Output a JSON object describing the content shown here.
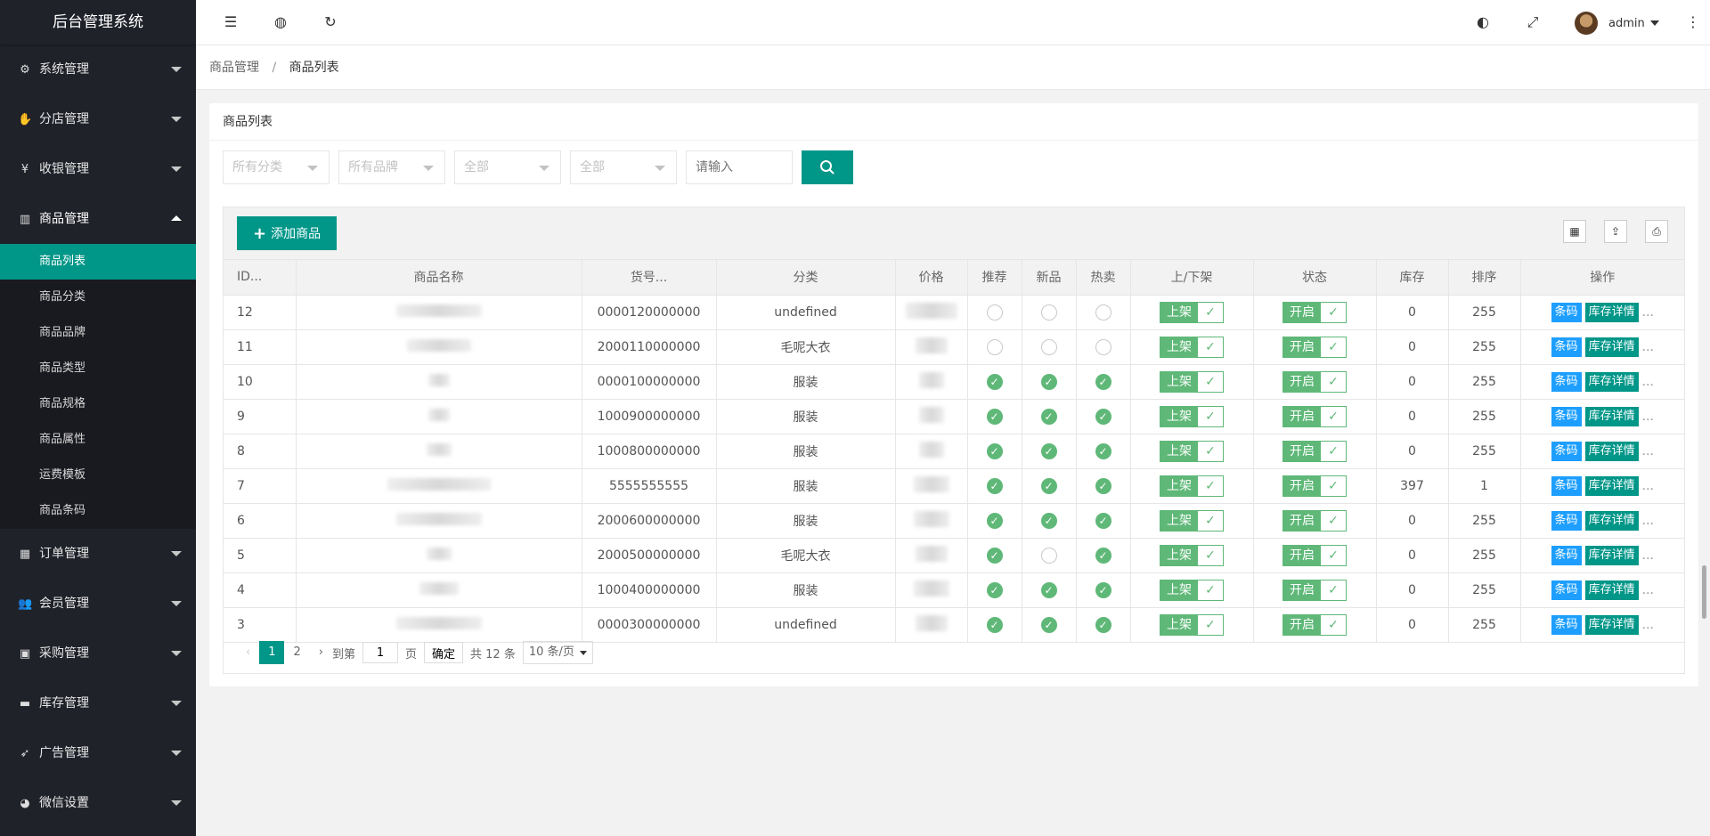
{
  "app_title": "后台管理系统",
  "sidebar": {
    "top_items": [
      {
        "label": "系统管理",
        "icon": "gear-icon",
        "glyph": "⚙"
      },
      {
        "label": "分店管理",
        "icon": "hand-icon",
        "glyph": "✋"
      },
      {
        "label": "收银管理",
        "icon": "yen-icon",
        "glyph": "¥"
      },
      {
        "label": "商品管理",
        "icon": "bar-chart-icon",
        "glyph": "▥"
      }
    ],
    "sub_items": [
      "商品列表",
      "商品分类",
      "商品品牌",
      "商品类型",
      "商品规格",
      "商品属性",
      "运费模板",
      "商品条码"
    ],
    "bottom_items": [
      {
        "label": "订单管理",
        "icon": "calendar-icon",
        "glyph": "▦"
      },
      {
        "label": "会员管理",
        "icon": "users-icon",
        "glyph": "👥"
      },
      {
        "label": "采购管理",
        "icon": "briefcase-icon",
        "glyph": "▣"
      },
      {
        "label": "库存管理",
        "icon": "folder-icon",
        "glyph": "▬"
      },
      {
        "label": "广告管理",
        "icon": "rocket-icon",
        "glyph": "➶"
      },
      {
        "label": "微信设置",
        "icon": "wechat-icon",
        "glyph": "◕"
      }
    ]
  },
  "header": {
    "user_name": "admin"
  },
  "breadcrumb": {
    "parent": "商品管理",
    "separator": "/",
    "current": "商品列表"
  },
  "card": {
    "title": "商品列表",
    "filters": {
      "category": "所有分类",
      "brand": "所有品牌",
      "filter3": "全部",
      "filter4": "全部",
      "search_placeholder": "请输入"
    },
    "add_button": "添加商品"
  },
  "table": {
    "columns": [
      "ID...",
      "商品名称",
      "货号...",
      "分类",
      "价格",
      "推荐",
      "新品",
      "热卖",
      "上/下架",
      "状态",
      "库存",
      "排序",
      "操作"
    ],
    "rows": [
      {
        "id": "12",
        "sku": "0000120000000",
        "category": "undefined",
        "rec": false,
        "new": false,
        "hot": false,
        "shelf": "上架",
        "status": "开启",
        "stock": "0",
        "sort": "255"
      },
      {
        "id": "11",
        "sku": "2000110000000",
        "category": "毛呢大衣",
        "rec": false,
        "new": false,
        "hot": false,
        "shelf": "上架",
        "status": "开启",
        "stock": "0",
        "sort": "255"
      },
      {
        "id": "10",
        "sku": "0000100000000",
        "category": "服装",
        "rec": true,
        "new": true,
        "hot": true,
        "shelf": "上架",
        "status": "开启",
        "stock": "0",
        "sort": "255"
      },
      {
        "id": "9",
        "sku": "1000900000000",
        "category": "服装",
        "rec": true,
        "new": true,
        "hot": true,
        "shelf": "上架",
        "status": "开启",
        "stock": "0",
        "sort": "255"
      },
      {
        "id": "8",
        "sku": "1000800000000",
        "category": "服装",
        "rec": true,
        "new": true,
        "hot": true,
        "shelf": "上架",
        "status": "开启",
        "stock": "0",
        "sort": "255"
      },
      {
        "id": "7",
        "sku": "5555555555",
        "category": "服装",
        "rec": true,
        "new": true,
        "hot": true,
        "shelf": "上架",
        "status": "开启",
        "stock": "397",
        "sort": "1"
      },
      {
        "id": "6",
        "sku": "2000600000000",
        "category": "服装",
        "rec": true,
        "new": true,
        "hot": true,
        "shelf": "上架",
        "status": "开启",
        "stock": "0",
        "sort": "255"
      },
      {
        "id": "5",
        "sku": "2000500000000",
        "category": "毛呢大衣",
        "rec": true,
        "new": false,
        "hot": true,
        "shelf": "上架",
        "status": "开启",
        "stock": "0",
        "sort": "255"
      },
      {
        "id": "4",
        "sku": "1000400000000",
        "category": "服装",
        "rec": true,
        "new": true,
        "hot": true,
        "shelf": "上架",
        "status": "开启",
        "stock": "0",
        "sort": "255"
      },
      {
        "id": "3",
        "sku": "0000300000000",
        "category": "undefined",
        "rec": true,
        "new": true,
        "hot": true,
        "shelf": "上架",
        "status": "开启",
        "stock": "0",
        "sort": "255"
      }
    ],
    "op_barcode": "条码",
    "op_stock": "库存详情",
    "op_more": "..."
  },
  "pager": {
    "pages": [
      "1",
      "2"
    ],
    "goto_label": "到第",
    "page_value": "1",
    "page_suffix": "页",
    "confirm": "确定",
    "total": "共 12 条",
    "page_size": "10 条/页"
  },
  "colors": {
    "accent": "#009688",
    "success": "#5fb878",
    "info": "#1e9fff",
    "sidebar": "#20222a"
  }
}
